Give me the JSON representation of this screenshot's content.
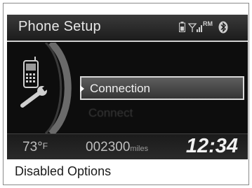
{
  "screen": {
    "title": "Phone Setup",
    "status_icons": [
      "battery-icon",
      "signal-icon",
      "roam-icon",
      "bluetooth-icon"
    ],
    "roam_text": "RM",
    "menu": {
      "selected_label": "Connection",
      "disabled_label": "Connect"
    },
    "footer": {
      "temperature": "73°",
      "temperature_unit": "F",
      "odometer": "002300",
      "odometer_unit": "miles",
      "clock": "12:34"
    }
  },
  "caption": "Disabled Options",
  "colors": {
    "screen_bg": "#0d0d0d",
    "header_text": "#e6e6e6",
    "highlight_border": "#d8d8d8"
  }
}
